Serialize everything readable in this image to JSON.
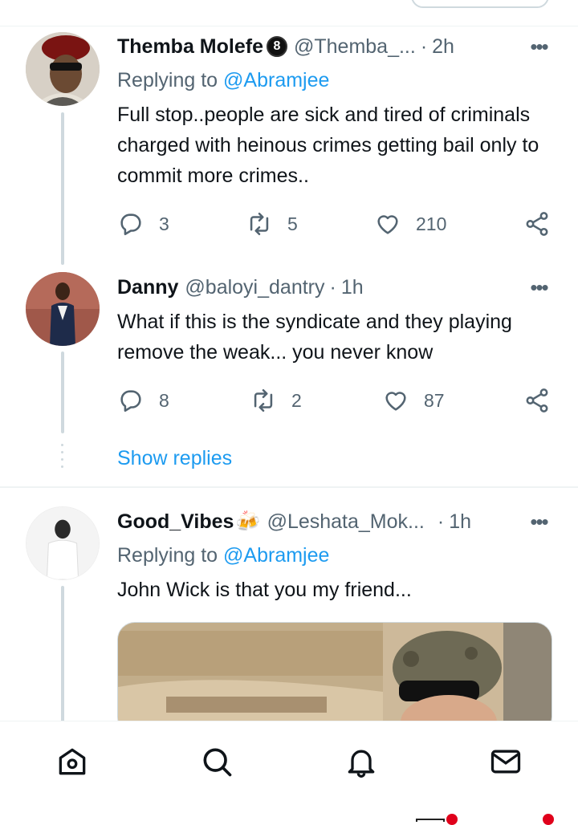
{
  "tweets": [
    {
      "name": "Themba Molefe",
      "badge": "8",
      "handle": "@Themba_...",
      "separator": "·",
      "time": "2h",
      "replying_prefix": "Replying to",
      "replying_to": "@Abramjee",
      "text": "Full stop..people are sick and tired of criminals charged with heinous crimes getting bail only to commit more crimes..",
      "replies": "3",
      "retweets": "5",
      "likes": "210"
    },
    {
      "name": "Danny",
      "handle": "@baloyi_dantry",
      "separator": "·",
      "time": "1h",
      "text": "What if this is the syndicate and they playing remove the weak... you never know",
      "replies": "8",
      "retweets": "2",
      "likes": "87"
    },
    {
      "name": "Good_Vibes",
      "emoji": "🍻",
      "handle": "@Leshata_Mok...",
      "separator": "·",
      "time": "1h",
      "replying_prefix": "Replying to",
      "replying_to": "@Abramjee",
      "text": "John Wick is that you my friend..."
    }
  ],
  "show_replies_label": "Show replies",
  "more_label": "•••",
  "nav": [
    "home-icon",
    "search-icon",
    "notifications-icon",
    "messages-icon"
  ],
  "colors": {
    "accent": "#1d9bf0",
    "secondary_text": "#536471",
    "thread_line": "#cfd9de",
    "notification_dot": "#e0001b"
  }
}
